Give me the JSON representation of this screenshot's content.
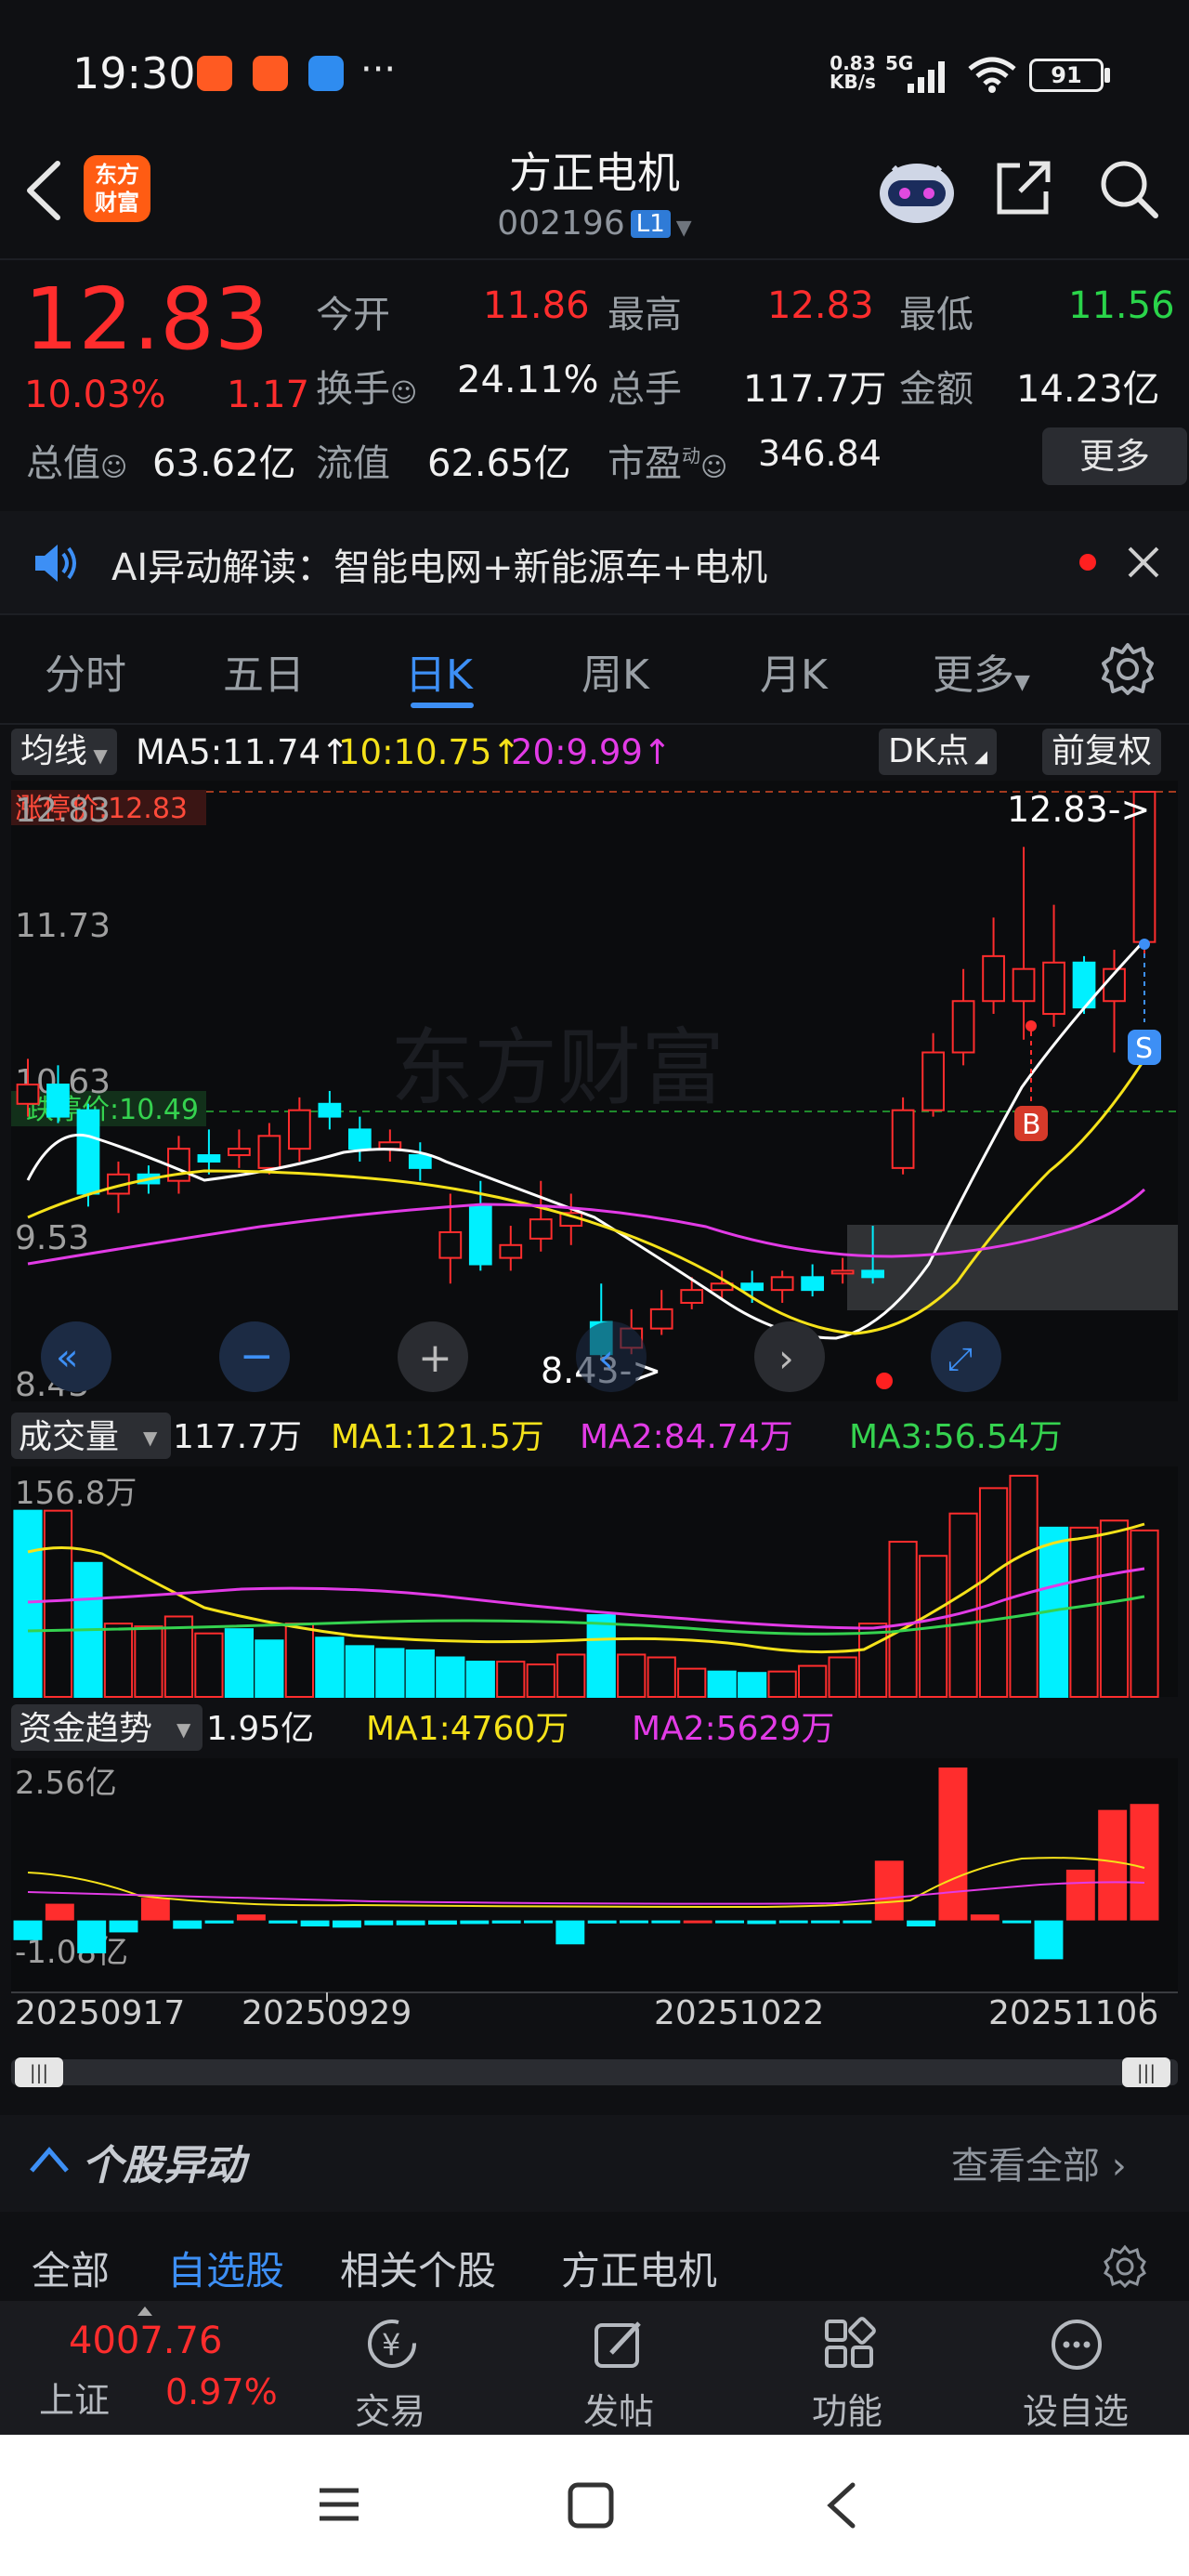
{
  "status_bar": {
    "time": "19:30",
    "net_speed_top": "0.83",
    "net_speed_bottom": "KB/s",
    "net_type": "5G",
    "battery": "91"
  },
  "header": {
    "logo_line1": "东方",
    "logo_line2": "财富",
    "title": "方正电机",
    "code": "002196",
    "level_badge": "L1"
  },
  "quote": {
    "price": "12.83",
    "change_pct": "10.03%",
    "change_amt": "1.17",
    "open_label": "今开",
    "open": "11.86",
    "high_label": "最高",
    "high": "12.83",
    "low_label": "最低",
    "low": "11.56",
    "turnover_label": "换手",
    "turnover": "24.11%",
    "volume_label": "总手",
    "volume": "117.7万",
    "amount_label": "金额",
    "amount": "14.23亿",
    "mktcap_label": "总值",
    "mktcap": "63.62亿",
    "float_label": "流值",
    "float_cap": "62.65亿",
    "pe_label": "市盈",
    "pe_sup": "动",
    "pe": "346.84",
    "more_label": "更多"
  },
  "ai_banner": {
    "text": "AI异动解读：智能电网+新能源车+电机"
  },
  "tabs": [
    {
      "label": "分时",
      "active": false
    },
    {
      "label": "五日",
      "active": false
    },
    {
      "label": "日K",
      "active": true
    },
    {
      "label": "周K",
      "active": false
    },
    {
      "label": "月K",
      "active": false
    },
    {
      "label": "更多",
      "active": false
    }
  ],
  "main_chart": {
    "indicator_label": "均线",
    "ma5": "MA5:11.74",
    "ma10": "10:10.75",
    "ma20": "20:9.99",
    "dk_label": "DK点",
    "adjust_label": "前复权",
    "limit_up_label": "涨停价:12.83",
    "limit_down_label": "跌停价:10.49",
    "y_ticks": [
      "12.83",
      "11.73",
      "10.63",
      "9.53",
      "8.43"
    ],
    "max_marker": "12.83->",
    "min_marker": "8.43->",
    "buy_marker": "B",
    "sell_marker": "S",
    "watermark": "东方财富"
  },
  "volume_chart": {
    "indicator_label": "成交量",
    "current": "117.7万",
    "ma1": "MA1:121.5万",
    "ma2": "MA2:84.74万",
    "ma3": "MA3:56.54万",
    "y_max": "156.8万"
  },
  "fund_chart": {
    "indicator_label": "资金趋势",
    "current": "1.95亿",
    "ma1": "MA1:4760万",
    "ma2": "MA2:5629万",
    "y_max": "2.56亿",
    "y_min": "-1.08亿"
  },
  "x_axis": [
    "20250917",
    "20250929",
    "20251022",
    "20251106"
  ],
  "colors": {
    "up": "#ff2d2d",
    "down": "#00f0ff",
    "ma5": "#ffffff",
    "ma10": "#f5e21a",
    "ma20": "#e23be6",
    "accent": "#3d8ff5"
  },
  "chart_data": {
    "type": "candlestick",
    "y_range": [
      8.43,
      12.83
    ],
    "candles": [
      {
        "o": 10.4,
        "c": 10.55,
        "h": 10.75,
        "l": 10.3
      },
      {
        "o": 10.55,
        "c": 10.3,
        "h": 10.7,
        "l": 10.25
      },
      {
        "o": 10.35,
        "c": 9.7,
        "h": 10.4,
        "l": 9.6
      },
      {
        "o": 9.7,
        "c": 9.85,
        "h": 9.95,
        "l": 9.55
      },
      {
        "o": 9.85,
        "c": 9.78,
        "h": 9.92,
        "l": 9.7
      },
      {
        "o": 9.8,
        "c": 10.05,
        "h": 10.15,
        "l": 9.7
      },
      {
        "o": 10.0,
        "c": 9.95,
        "h": 10.2,
        "l": 9.85
      },
      {
        "o": 10.0,
        "c": 10.05,
        "h": 10.2,
        "l": 9.9
      },
      {
        "o": 9.9,
        "c": 10.15,
        "h": 10.25,
        "l": 9.85
      },
      {
        "o": 10.05,
        "c": 10.35,
        "h": 10.45,
        "l": 9.95
      },
      {
        "o": 10.4,
        "c": 10.3,
        "h": 10.5,
        "l": 10.2
      },
      {
        "o": 10.2,
        "c": 10.05,
        "h": 10.3,
        "l": 9.95
      },
      {
        "o": 10.05,
        "c": 10.1,
        "h": 10.2,
        "l": 9.95
      },
      {
        "o": 10.0,
        "c": 9.9,
        "h": 10.1,
        "l": 9.8
      },
      {
        "o": 9.2,
        "c": 9.4,
        "h": 9.7,
        "l": 9.0
      },
      {
        "o": 9.6,
        "c": 9.15,
        "h": 9.8,
        "l": 9.1
      },
      {
        "o": 9.2,
        "c": 9.3,
        "h": 9.45,
        "l": 9.1
      },
      {
        "o": 9.35,
        "c": 9.5,
        "h": 9.8,
        "l": 9.25
      },
      {
        "o": 9.45,
        "c": 9.55,
        "h": 9.7,
        "l": 9.3
      },
      {
        "o": 8.7,
        "c": 8.45,
        "h": 9.0,
        "l": 8.43
      },
      {
        "o": 8.5,
        "c": 8.65,
        "h": 8.8,
        "l": 8.45
      },
      {
        "o": 8.65,
        "c": 8.8,
        "h": 8.95,
        "l": 8.6
      },
      {
        "o": 8.85,
        "c": 8.95,
        "h": 9.05,
        "l": 8.8
      },
      {
        "o": 8.95,
        "c": 9.0,
        "h": 9.1,
        "l": 8.88
      },
      {
        "o": 9.0,
        "c": 8.95,
        "h": 9.1,
        "l": 8.85
      },
      {
        "o": 8.95,
        "c": 9.05,
        "h": 9.1,
        "l": 8.85
      },
      {
        "o": 9.05,
        "c": 8.95,
        "h": 9.15,
        "l": 8.9
      },
      {
        "o": 9.1,
        "c": 9.1,
        "h": 9.2,
        "l": 9.0
      },
      {
        "o": 9.1,
        "c": 9.05,
        "h": 9.45,
        "l": 9.0
      },
      {
        "o": 9.9,
        "c": 10.35,
        "h": 10.45,
        "l": 9.85
      },
      {
        "o": 10.35,
        "c": 10.8,
        "h": 10.95,
        "l": 10.3
      },
      {
        "o": 10.8,
        "c": 11.2,
        "h": 11.45,
        "l": 10.7
      },
      {
        "o": 11.2,
        "c": 11.55,
        "h": 11.85,
        "l": 11.1
      },
      {
        "o": 11.2,
        "c": 11.45,
        "h": 12.4,
        "l": 10.9
      },
      {
        "o": 11.1,
        "c": 11.5,
        "h": 11.95,
        "l": 11.0
      },
      {
        "o": 11.5,
        "c": 11.15,
        "h": 11.55,
        "l": 11.1
      },
      {
        "o": 11.2,
        "c": 11.45,
        "h": 11.6,
        "l": 10.8
      },
      {
        "o": 11.66,
        "c": 12.83,
        "h": 12.83,
        "l": 11.56
      }
    ],
    "volume_range": [
      0,
      156.8
    ],
    "volumes": [
      {
        "v": 132,
        "up": false
      },
      {
        "v": 132,
        "up": true
      },
      {
        "v": 95,
        "up": false
      },
      {
        "v": 52,
        "up": true
      },
      {
        "v": 50,
        "up": true
      },
      {
        "v": 57,
        "up": true
      },
      {
        "v": 45,
        "up": true
      },
      {
        "v": 48,
        "up": false
      },
      {
        "v": 40,
        "up": false
      },
      {
        "v": 52,
        "up": true
      },
      {
        "v": 42,
        "up": false
      },
      {
        "v": 36,
        "up": false
      },
      {
        "v": 34,
        "up": false
      },
      {
        "v": 33,
        "up": false
      },
      {
        "v": 28,
        "up": false
      },
      {
        "v": 25,
        "up": false
      },
      {
        "v": 25,
        "up": true
      },
      {
        "v": 23,
        "up": true
      },
      {
        "v": 30,
        "up": true
      },
      {
        "v": 58,
        "up": false
      },
      {
        "v": 30,
        "up": true
      },
      {
        "v": 28,
        "up": true
      },
      {
        "v": 20,
        "up": true
      },
      {
        "v": 18,
        "up": false
      },
      {
        "v": 17,
        "up": false
      },
      {
        "v": 18,
        "up": true
      },
      {
        "v": 22,
        "up": true
      },
      {
        "v": 28,
        "up": true
      },
      {
        "v": 52,
        "up": true
      },
      {
        "v": 110,
        "up": true
      },
      {
        "v": 100,
        "up": true
      },
      {
        "v": 130,
        "up": true
      },
      {
        "v": 148,
        "up": true
      },
      {
        "v": 158,
        "up": true
      },
      {
        "v": 120,
        "up": false
      },
      {
        "v": 120,
        "up": true
      },
      {
        "v": 125,
        "up": true
      },
      {
        "v": 118,
        "up": true
      }
    ],
    "fund_range": [
      -1.08,
      2.56
    ],
    "funds": [
      -0.33,
      0.28,
      -0.55,
      -0.2,
      0.38,
      -0.14,
      -0.05,
      0.1,
      -0.05,
      -0.1,
      -0.12,
      -0.08,
      -0.08,
      -0.07,
      -0.06,
      -0.05,
      -0.03,
      -0.4,
      -0.05,
      -0.02,
      -0.01,
      0.0,
      -0.02,
      -0.06,
      -0.04,
      -0.04,
      -0.03,
      1.0,
      -0.1,
      2.56,
      0.1,
      -0.04,
      -0.65,
      0.85,
      1.85,
      1.95
    ]
  },
  "stock_alert": {
    "title": "个股异动",
    "view_all": "查看全部"
  },
  "alert_tabs": [
    {
      "label": "全部",
      "active": false
    },
    {
      "label": "自选股",
      "active": true
    },
    {
      "label": "相关个股",
      "active": false
    },
    {
      "label": "方正电机",
      "active": false
    }
  ],
  "bottom_nav": {
    "index_value": "4007.76",
    "index_name": "上证",
    "index_change": "0.97%",
    "items": [
      {
        "label": "交易",
        "icon": "yuan-exchange-icon"
      },
      {
        "label": "发帖",
        "icon": "edit-post-icon"
      },
      {
        "label": "功能",
        "icon": "grid-apps-icon"
      },
      {
        "label": "设自选",
        "icon": "more-dots-icon"
      }
    ]
  }
}
